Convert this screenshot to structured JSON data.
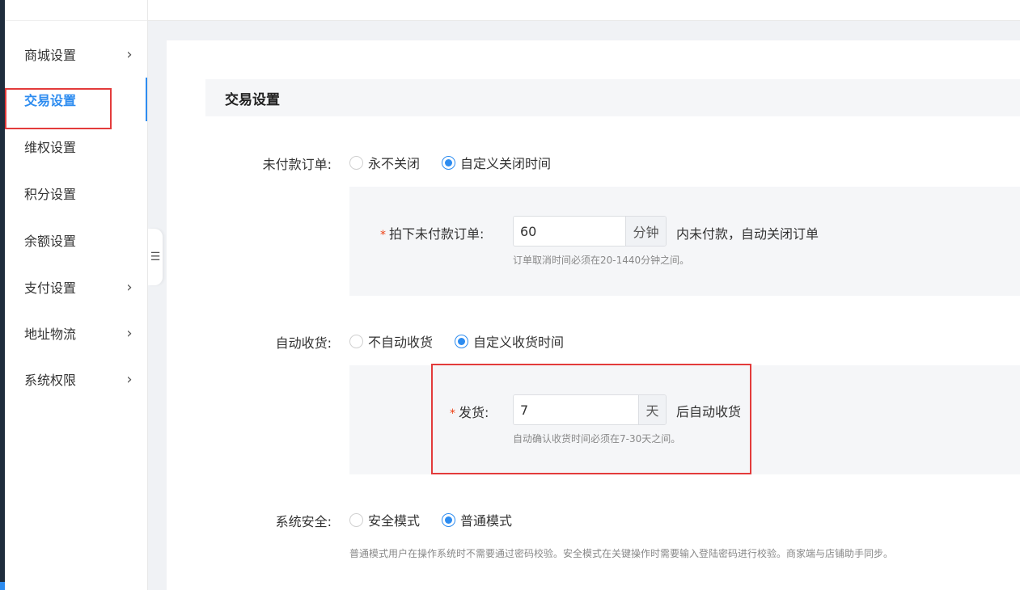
{
  "sidebar": {
    "items": [
      {
        "label": "商城设置",
        "chevron": true,
        "active": false
      },
      {
        "label": "交易设置",
        "chevron": false,
        "active": true
      },
      {
        "label": "维权设置",
        "chevron": false,
        "active": false
      },
      {
        "label": "积分设置",
        "chevron": false,
        "active": false
      },
      {
        "label": "余额设置",
        "chevron": false,
        "active": false
      },
      {
        "label": "支付设置",
        "chevron": true,
        "active": false
      },
      {
        "label": "地址物流",
        "chevron": true,
        "active": false
      },
      {
        "label": "系统权限",
        "chevron": true,
        "active": false
      }
    ],
    "collapse_icon": "menu-fold-icon"
  },
  "section": {
    "title": "交易设置"
  },
  "unpaid_order": {
    "label": "未付款订单:",
    "options": [
      "永不关闭",
      "自定义关闭时间"
    ],
    "selected": 1,
    "field_label": "拍下未付款订单:",
    "value": "60",
    "unit": "分钟",
    "suffix": "内未付款，自动关闭订单",
    "hint": "订单取消时间必须在20-1440分钟之间。"
  },
  "auto_receive": {
    "label": "自动收货:",
    "options": [
      "不自动收货",
      "自定义收货时间"
    ],
    "selected": 1,
    "field_label": "发货:",
    "value": "7",
    "unit": "天",
    "suffix": "后自动收货",
    "hint": "自动确认收货时间必须在7-30天之间。"
  },
  "security": {
    "label": "系统安全:",
    "options": [
      "安全模式",
      "普通模式"
    ],
    "selected": 1,
    "hint": "普通模式用户在操作系统时不需要通过密码校验。安全模式在关键操作时需要输入登陆密码进行校验。商家端与店铺助手同步。"
  },
  "colors": {
    "accent": "#2d8cf0",
    "highlight": "#e33b3b",
    "required": "#ed4014"
  }
}
